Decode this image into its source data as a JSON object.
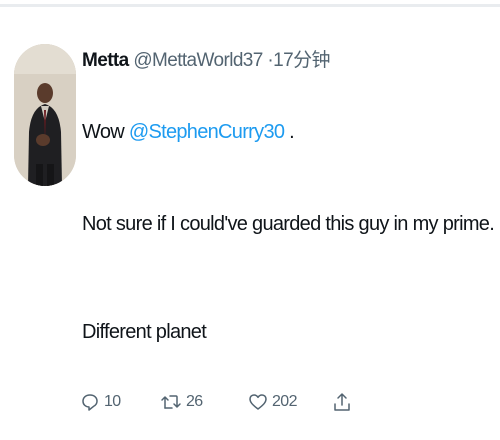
{
  "tweet": {
    "author": {
      "display_name": "Metta",
      "handle": "@MettaWorld37",
      "separator": " ·",
      "time": "17分钟"
    },
    "text": {
      "line1_prefix": "Wow ",
      "line1_mention": "@StephenCurry30",
      "line1_suffix": " .",
      "line2": "Not sure if I could've guarded this guy in my prime.",
      "line3": "Different planet"
    },
    "actions": {
      "reply_count": "10",
      "retweet_count": "26",
      "like_count": "202",
      "icons": [
        "reply-icon",
        "retweet-icon",
        "like-icon",
        "share-icon"
      ]
    }
  },
  "colors": {
    "text_primary": "#0f1419",
    "text_secondary": "#536471",
    "link": "#1d9bf0",
    "divider": "#e9ecef"
  }
}
